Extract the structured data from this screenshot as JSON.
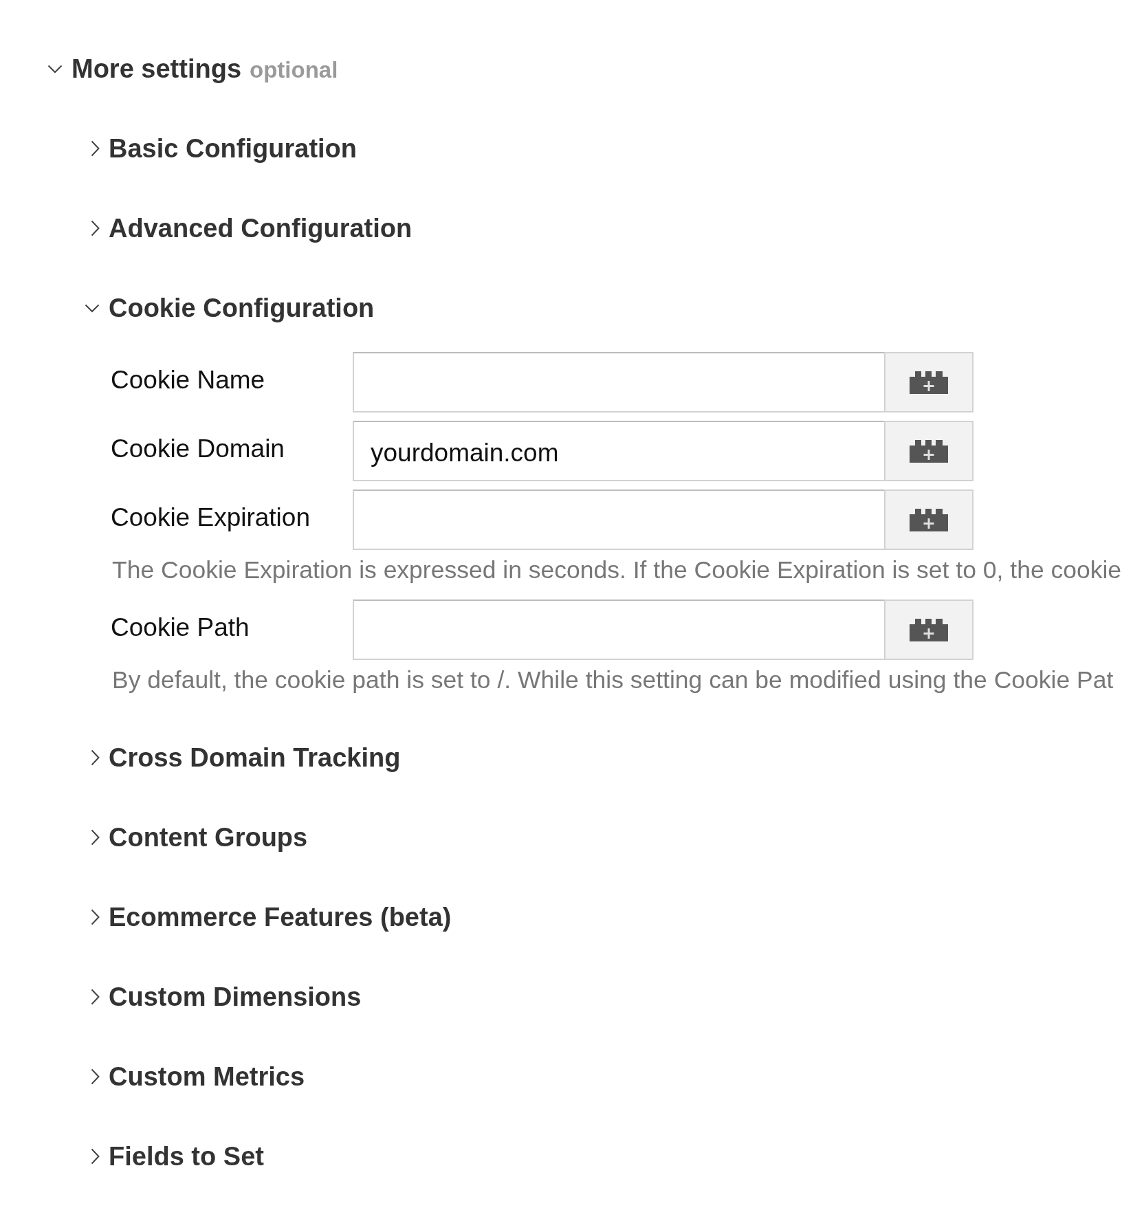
{
  "more_settings": {
    "title": "More settings",
    "hint": "optional",
    "expanded": true
  },
  "sections": [
    {
      "title": "Basic Configuration",
      "expanded": false
    },
    {
      "title": "Advanced Configuration",
      "expanded": false
    },
    {
      "title": "Cookie Configuration",
      "expanded": true,
      "fields": [
        {
          "label": "Cookie Name"
        },
        {
          "label": "Cookie Domain",
          "value": "yourdomain.com"
        },
        {
          "label": "Cookie Expiration",
          "help": "The Cookie Expiration is expressed in seconds. If the Cookie Expiration is set to 0, the cookie"
        },
        {
          "label": "Cookie Path",
          "help": "By default, the cookie path is set to /. While this setting can be modified using the Cookie Pat"
        }
      ]
    },
    {
      "title": "Cross Domain Tracking",
      "expanded": false
    },
    {
      "title": "Content Groups",
      "expanded": false
    },
    {
      "title": "Ecommerce Features (beta)",
      "expanded": false
    },
    {
      "title": "Custom Dimensions",
      "expanded": false
    },
    {
      "title": "Custom Metrics",
      "expanded": false
    },
    {
      "title": "Fields to Set",
      "expanded": false
    }
  ]
}
